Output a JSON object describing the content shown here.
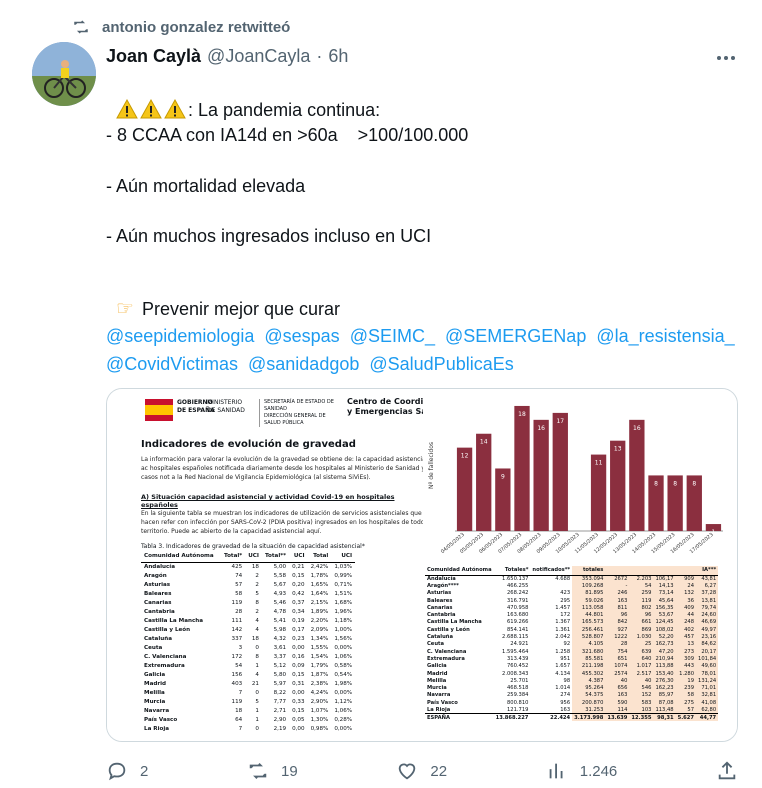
{
  "retweet": {
    "text": "antonio gonzalez retwitteó",
    "icon": "retweet-icon"
  },
  "author": {
    "name": "Joan Caylà",
    "handle": "@JoanCayla",
    "separator": "·",
    "time": "6h"
  },
  "tweet": {
    "line1": ": La pandemia continua:",
    "line2": "- 8 CCAA con IA14d en >60a    >100/100.000",
    "line3": "- Aún mortalidad elevada",
    "line4": "- Aún muchos ingresados incluso en UCI",
    "line5": "Prevenir mejor que curar",
    "mentions": [
      "@seepidemiologia",
      "@sespas",
      "@SEIMC_",
      "@SEMERGENap",
      "@la_resistensia_",
      "@CovidVictimas",
      "@sanidadgob",
      "@SaludPublicaEs"
    ]
  },
  "doc": {
    "gob": "GOBIERNO\nDE ESPAÑA",
    "ministerio": "MINISTERIO\nDE SANIDAD",
    "secretaria": "SECRETARÍA DE ESTADO DE SANIDAD\nDIRECCIÓN GENERAL DE SALUD PÚBLICA",
    "centro": "Centro de Coordinació\ny Emergencias Sar",
    "title": "Indicadores de evolución de gravedad",
    "para": "La información para valorar la evolución de la gravedad se obtiene de: la capacidad asistencial y ac hospitales españoles notificada diariamente desde los hospitales al Ministerio de Sanidad y los casos not a la Red Nacional de Vigilancia Epidemiológica (al sistema SiViEs).",
    "sub": "A)   Situación capacidad asistencial y actividad Covid-19 en hospitales españoles",
    "para2": "En la siguiente tabla se muestran los indicadores de utilización de servicios asistenciales que hacen refer con infección por SARS-CoV-2 (PDIA positiva) ingresados en los hospitales de todo el territorio. Puede ac abierto de la capacidad asistencial aquí.",
    "tabletitle": "Tabla 3. Indicadores de gravedad de la situación de capacidad asistencial*",
    "headers": [
      "Comunidad Autónoma",
      "Total*",
      "UCI",
      "Total**",
      "UCI",
      "Total",
      "UCI"
    ],
    "rows": [
      [
        "Andalucía",
        "425",
        "18",
        "5,00",
        "0,21",
        "2,42%",
        "1,03%"
      ],
      [
        "Aragón",
        "74",
        "2",
        "5,58",
        "0,15",
        "1,78%",
        "0,99%"
      ],
      [
        "Asturias",
        "57",
        "2",
        "5,67",
        "0,20",
        "1,65%",
        "0,71%"
      ],
      [
        "Baleares",
        "58",
        "5",
        "4,93",
        "0,42",
        "1,64%",
        "1,51%"
      ],
      [
        "Canarias",
        "119",
        "8",
        "5,46",
        "0,37",
        "2,15%",
        "1,68%"
      ],
      [
        "Cantabria",
        "28",
        "2",
        "4,78",
        "0,34",
        "1,89%",
        "1,96%"
      ],
      [
        "Castilla La Mancha",
        "111",
        "4",
        "5,41",
        "0,19",
        "2,20%",
        "1,18%"
      ],
      [
        "Castilla y León",
        "142",
        "4",
        "5,98",
        "0,17",
        "2,09%",
        "1,00%"
      ],
      [
        "Cataluña",
        "337",
        "18",
        "4,32",
        "0,23",
        "1,34%",
        "1,56%"
      ],
      [
        "Ceuta",
        "3",
        "0",
        "3,61",
        "0,00",
        "1,55%",
        "0,00%"
      ],
      [
        "C. Valenciana",
        "172",
        "8",
        "3,37",
        "0,16",
        "1,54%",
        "1,06%"
      ],
      [
        "Extremadura",
        "54",
        "1",
        "5,12",
        "0,09",
        "1,79%",
        "0,58%"
      ],
      [
        "Galicia",
        "156",
        "4",
        "5,80",
        "0,15",
        "1,87%",
        "0,54%"
      ],
      [
        "Madrid",
        "403",
        "21",
        "5,97",
        "0,31",
        "2,38%",
        "1,98%"
      ],
      [
        "Melilla",
        "7",
        "0",
        "8,22",
        "0,00",
        "4,24%",
        "0,00%"
      ],
      [
        "Murcia",
        "119",
        "5",
        "7,77",
        "0,33",
        "2,90%",
        "1,12%"
      ],
      [
        "Navarra",
        "18",
        "1",
        "2,71",
        "0,15",
        "1,07%",
        "1,06%"
      ],
      [
        "País Vasco",
        "64",
        "1",
        "2,90",
        "0,05",
        "1,30%",
        "0,28%"
      ],
      [
        "La Rioja",
        "7",
        "0",
        "2,19",
        "0,00",
        "0,98%",
        "0,00%"
      ]
    ]
  },
  "chart_data": {
    "type": "bar",
    "title": "",
    "ylabel": "Nº de fallecidos",
    "color": "#8b2f3f",
    "categories": [
      "04/05/2023",
      "05/05/2023",
      "06/05/2023",
      "07/05/2023",
      "08/05/2023",
      "09/05/2023",
      "10/05/2023",
      "11/05/2023",
      "12/05/2023",
      "13/05/2023",
      "14/05/2023",
      "15/05/2023",
      "16/05/2023",
      "17/05/2023"
    ],
    "values": [
      12,
      14,
      9,
      18,
      16,
      17,
      0,
      11,
      13,
      16,
      8,
      8,
      8,
      1
    ],
    "ylim": [
      0,
      19
    ]
  },
  "table2": {
    "headers": [
      "Comunidad Autónoma",
      "Totales*",
      "notificados**",
      "totales",
      "",
      "",
      "",
      "",
      "IA***"
    ],
    "rows": [
      [
        "Andalucía",
        "1.650.137",
        "4.688",
        "353.094",
        "2672",
        "2.203",
        "106,17",
        "909",
        "43,81"
      ],
      [
        "Aragón****",
        "466.255",
        "",
        "109.268",
        "-",
        "54",
        "14,13",
        "24",
        "6,27"
      ],
      [
        "Asturias",
        "268.242",
        "423",
        "81.895",
        "246",
        "259",
        "73,14",
        "132",
        "37,28"
      ],
      [
        "Baleares",
        "316.791",
        "295",
        "59.026",
        "163",
        "119",
        "45,64",
        "36",
        "13,81"
      ],
      [
        "Canarias",
        "470.958",
        "1.457",
        "113.058",
        "811",
        "802",
        "156,35",
        "409",
        "79,74"
      ],
      [
        "Cantabria",
        "163.680",
        "172",
        "44.801",
        "96",
        "96",
        "53,67",
        "44",
        "24,60"
      ],
      [
        "Castilla La Mancha",
        "619.266",
        "1.367",
        "165.573",
        "842",
        "661",
        "124,45",
        "248",
        "46,69"
      ],
      [
        "Castilla y León",
        "854.141",
        "1.361",
        "256.461",
        "927",
        "869",
        "108,02",
        "402",
        "49,97"
      ],
      [
        "Cataluña",
        "2.688.115",
        "2.042",
        "528.807",
        "1222",
        "1.030",
        "52,20",
        "457",
        "23,16"
      ],
      [
        "Ceuta",
        "24.921",
        "92",
        "4.105",
        "28",
        "25",
        "162,73",
        "13",
        "84,62"
      ],
      [
        "C. Valenciana",
        "1.595.464",
        "1.258",
        "321.680",
        "754",
        "639",
        "47,20",
        "273",
        "20,17"
      ],
      [
        "Extremadura",
        "313.439",
        "951",
        "85.581",
        "651",
        "640",
        "210,94",
        "309",
        "101,84"
      ],
      [
        "Galicia",
        "760.452",
        "1.657",
        "211.198",
        "1074",
        "1.017",
        "113,88",
        "443",
        "49,60"
      ],
      [
        "Madrid",
        "2.008.343",
        "4.134",
        "455.302",
        "2574",
        "2.517",
        "153,40",
        "1.280",
        "78,01"
      ],
      [
        "Melilla",
        "25.701",
        "98",
        "4.387",
        "40",
        "40",
        "276,30",
        "19",
        "131,24"
      ],
      [
        "Murcia",
        "468.518",
        "1.014",
        "95.264",
        "656",
        "546",
        "162,23",
        "239",
        "71,01"
      ],
      [
        "Navarra",
        "259.384",
        "274",
        "54.375",
        "163",
        "152",
        "85,97",
        "58",
        "32,81"
      ],
      [
        "País Vasco",
        "800.810",
        "956",
        "200.870",
        "590",
        "583",
        "87,08",
        "275",
        "41,08"
      ],
      [
        "La Rioja",
        "121.719",
        "163",
        "31.253",
        "114",
        "103",
        "113,48",
        "57",
        "62,80"
      ]
    ],
    "total": [
      "ESPAÑA",
      "13.868.227",
      "22.424",
      "3.173.998",
      "13.639",
      "12.355",
      "98,31",
      "5.627",
      "44,77"
    ]
  },
  "actions": {
    "replies": "2",
    "retweets": "19",
    "likes": "22",
    "views": "1.246"
  }
}
